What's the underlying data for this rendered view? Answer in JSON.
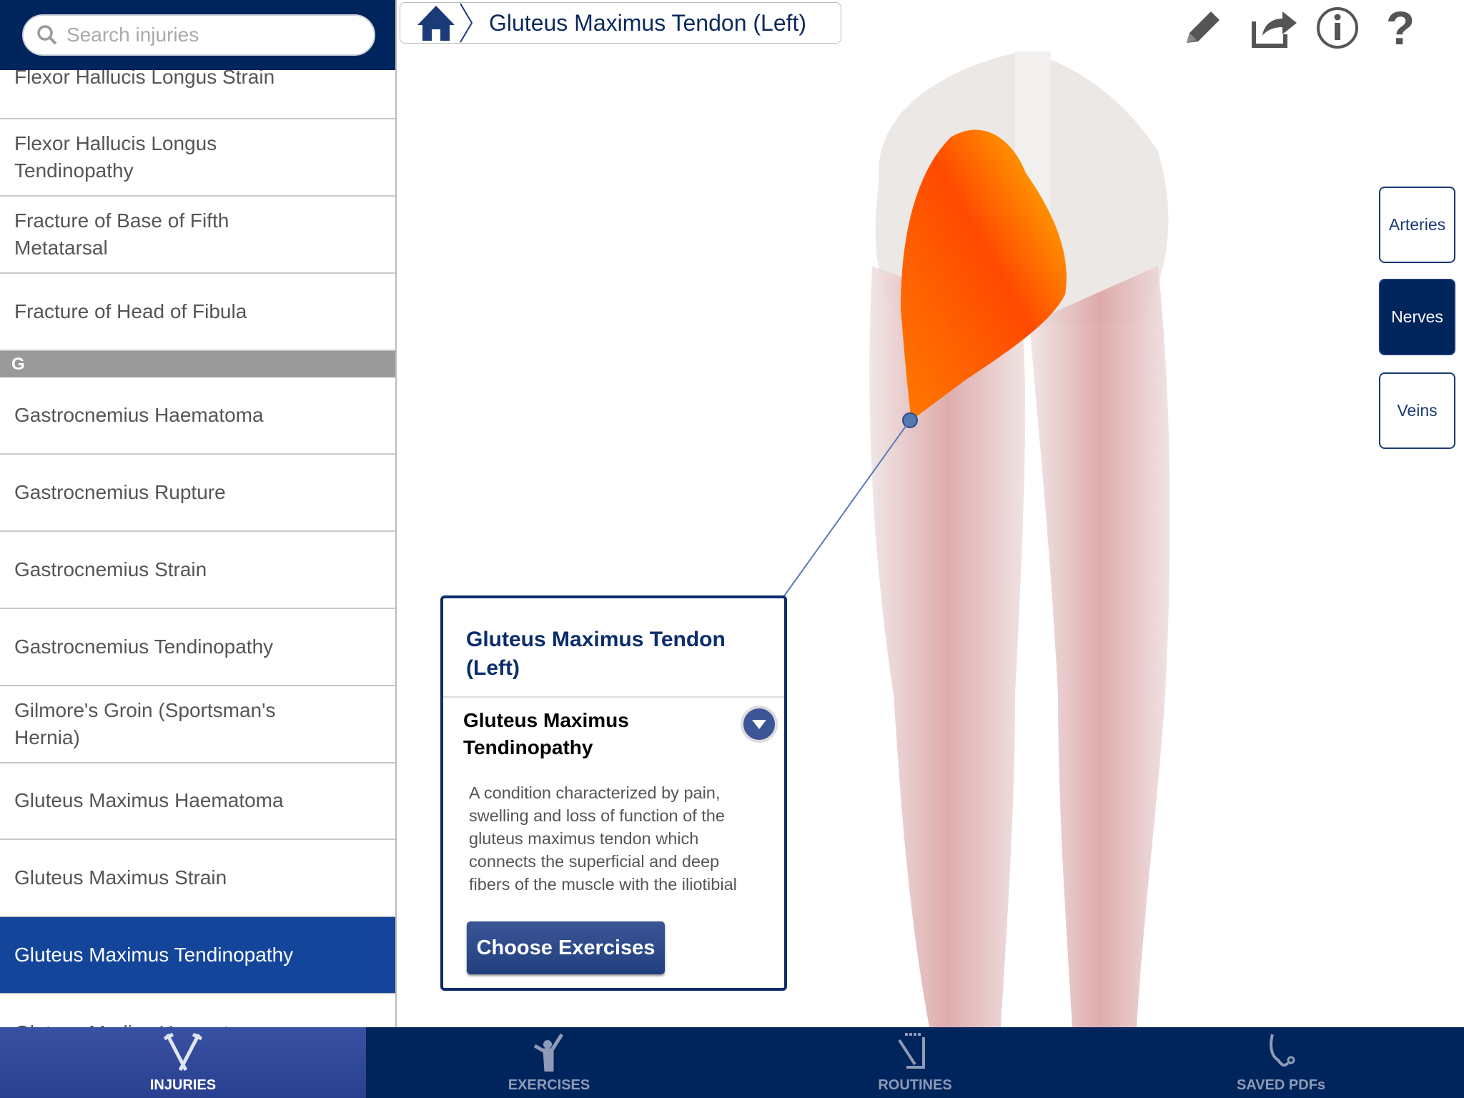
{
  "search": {
    "placeholder": "Search injuries"
  },
  "sidebar": {
    "items": [
      {
        "label": "Flexor Hallucis Longus Strain"
      },
      {
        "label": "Flexor Hallucis Longus Tendinopathy"
      },
      {
        "label": "Fracture of Base of Fifth Metatarsal"
      },
      {
        "label": "Fracture of Head of Fibula"
      },
      {
        "label": "Gastrocnemius Haematoma"
      },
      {
        "label": "Gastrocnemius Rupture"
      },
      {
        "label": "Gastrocnemius Strain"
      },
      {
        "label": "Gastrocnemius Tendinopathy"
      },
      {
        "label": "Gilmore's Groin (Sportsman's Hernia)"
      },
      {
        "label": "Gluteus Maximus Haematoma"
      },
      {
        "label": "Gluteus Maximus Strain"
      },
      {
        "label": "Gluteus Maximus Tendinopathy",
        "selected": true
      },
      {
        "label": "Gluteus Medius Haematoma"
      }
    ],
    "section_g": "G"
  },
  "breadcrumb": {
    "title": "Gluteus Maximus Tendon (Left)"
  },
  "layers": {
    "arteries": "Arteries",
    "nerves": "Nerves",
    "veins": "Veins",
    "active": "Nerves"
  },
  "popup": {
    "title": "Gluteus Maximus Tendon (Left)",
    "injury": "Gluteus Maximus Tendinopathy",
    "description": "A condition characterized by pain, swelling and loss of function of the gluteus maximus tendon which connects the superficial and deep fibers of the muscle with the iliotibial tract and the gluteal tuberosity of the",
    "button": "Choose Exercises"
  },
  "tabs": [
    {
      "label": "INJURIES",
      "active": true
    },
    {
      "label": "EXERCISES"
    },
    {
      "label": "ROUTINES"
    },
    {
      "label": "SAVED PDFs"
    }
  ],
  "colors": {
    "navy": "#00245c",
    "selected": "#13469b",
    "highlight": "#ff5a00"
  }
}
